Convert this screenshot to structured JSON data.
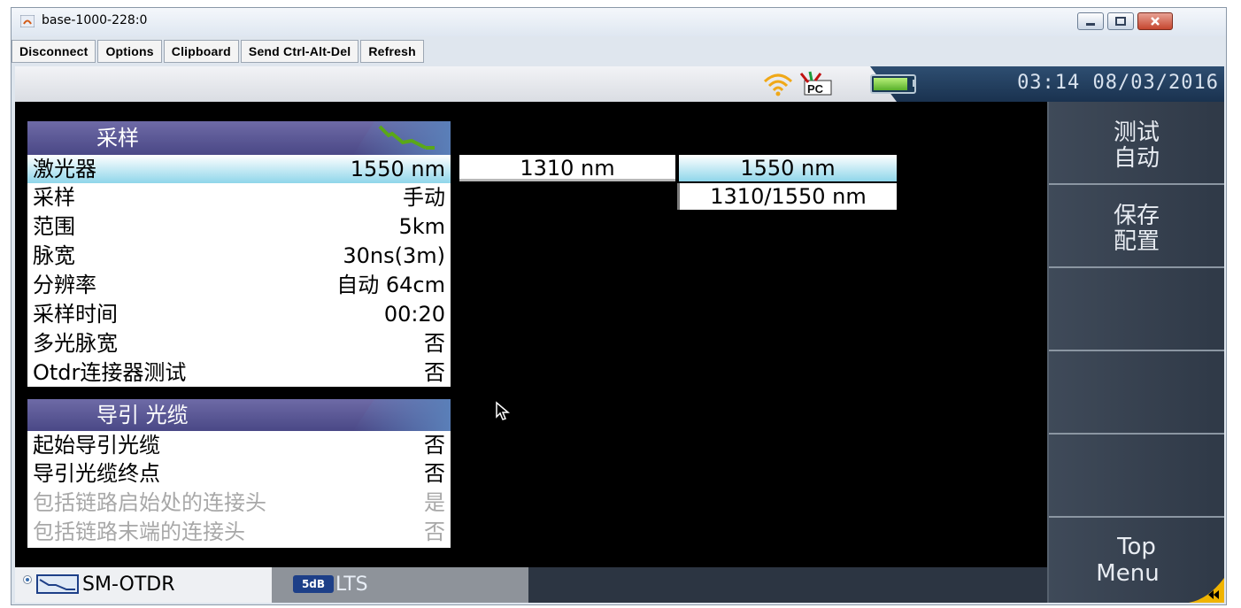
{
  "window": {
    "title": "base-1000-228:0"
  },
  "toolbar": {
    "buttons": [
      "Disconnect",
      "Options",
      "Clipboard",
      "Send Ctrl-Alt-Del",
      "Refresh"
    ]
  },
  "status": {
    "time": "03:14",
    "date": "08/03/2016"
  },
  "sampling_panel": {
    "title": "采样",
    "rows": [
      {
        "label": "激光器",
        "value": "1550 nm"
      },
      {
        "label": "采样",
        "value": "手动"
      },
      {
        "label": "范围",
        "value": "5km"
      },
      {
        "label": "脉宽",
        "value": "30ns(3m)"
      },
      {
        "label": "分辨率",
        "value": "自动 64cm"
      },
      {
        "label": "采样时间",
        "value": "00:20"
      },
      {
        "label": "多光脉宽",
        "value": "否"
      },
      {
        "label": "Otdr连接器测试",
        "value": "否"
      }
    ]
  },
  "laser_options": {
    "opt1": "1310 nm",
    "opt2": "1550 nm",
    "opt3": "1310/1550 nm"
  },
  "lead_panel": {
    "title": "导引 光缆",
    "rows": [
      {
        "label": "起始导引光缆",
        "value": "否"
      },
      {
        "label": "导引光缆终点",
        "value": "否"
      },
      {
        "label": "包括链路启始处的连接头",
        "value": "是"
      },
      {
        "label": "包括链路末端的连接头",
        "value": "否"
      }
    ]
  },
  "softkeys": [
    {
      "line1": "测试",
      "line2": "自动"
    },
    {
      "line1": "保存",
      "line2": "配置"
    },
    {
      "line1": "",
      "line2": ""
    },
    {
      "line1": "",
      "line2": ""
    },
    {
      "line1": "",
      "line2": ""
    },
    {
      "line1": "Top",
      "line2": "Menu"
    }
  ],
  "tabs": [
    {
      "label": "SM-OTDR",
      "icon_text": ""
    },
    {
      "label": "LTS",
      "icon_text": "5dB"
    }
  ],
  "colors": {
    "accent": "#4a4886",
    "selection": "#8fd6ea",
    "statusbar": "#1a324f"
  }
}
